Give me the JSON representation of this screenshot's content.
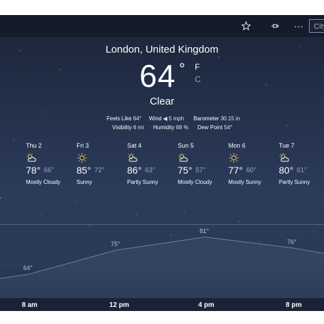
{
  "titlebar": {
    "city_placeholder": "City",
    "icons": [
      "star-icon",
      "pin-icon",
      "more-icon"
    ],
    "more_label": "···"
  },
  "location": "London, United Kingdom",
  "current": {
    "temp": "64",
    "degree_symbol": "°",
    "unit_f": "F",
    "unit_c": "C",
    "condition": "Clear"
  },
  "details": {
    "feels_like_label": "Feels Like",
    "feels_like_value": "64°",
    "wind_label": "Wind",
    "wind_value": "◀ 5 mph",
    "barometer_label": "Barometer",
    "barometer_value": "30.15 in",
    "visibility_label": "Visibility",
    "visibility_value": "6 mi",
    "humidity_label": "Humidity",
    "humidity_value": "68 %",
    "dew_point_label": "Dew Point",
    "dew_point_value": "54°"
  },
  "forecast": [
    {
      "day": "Thu 2",
      "hi": "78°",
      "lo": "66°",
      "cond": "Mostly Cloudy",
      "icon": "partly-cloudy-icon"
    },
    {
      "day": "Fri 3",
      "hi": "85°",
      "lo": "72°",
      "cond": "Sunny",
      "icon": "sun-icon"
    },
    {
      "day": "Sat 4",
      "hi": "86°",
      "lo": "63°",
      "cond": "Partly Sunny",
      "icon": "partly-cloudy-icon"
    },
    {
      "day": "Sun 5",
      "hi": "75°",
      "lo": "57°",
      "cond": "Mostly Cloudy",
      "icon": "partly-cloudy-icon"
    },
    {
      "day": "Mon 6",
      "hi": "77°",
      "lo": "60°",
      "cond": "Mostly Sunny",
      "icon": "sun-icon"
    },
    {
      "day": "Tue 7",
      "hi": "80°",
      "lo": "61°",
      "cond": "Partly Sunny",
      "icon": "partly-cloudy-icon"
    }
  ],
  "edge_mark": "'",
  "chart_data": {
    "type": "area",
    "x": [
      "8 am",
      "12 pm",
      "4 pm",
      "8 pm"
    ],
    "point_labels": [
      "64°",
      "75°",
      "81°",
      "76°"
    ],
    "values": [
      64,
      75,
      81,
      76
    ],
    "xlabel": "",
    "ylabel": ""
  },
  "colors": {
    "background_top": "#1b2438",
    "background_mid": "#2b3b5a",
    "chart_fill": "#3a4a68",
    "chart_line": "#6f7f9c"
  }
}
